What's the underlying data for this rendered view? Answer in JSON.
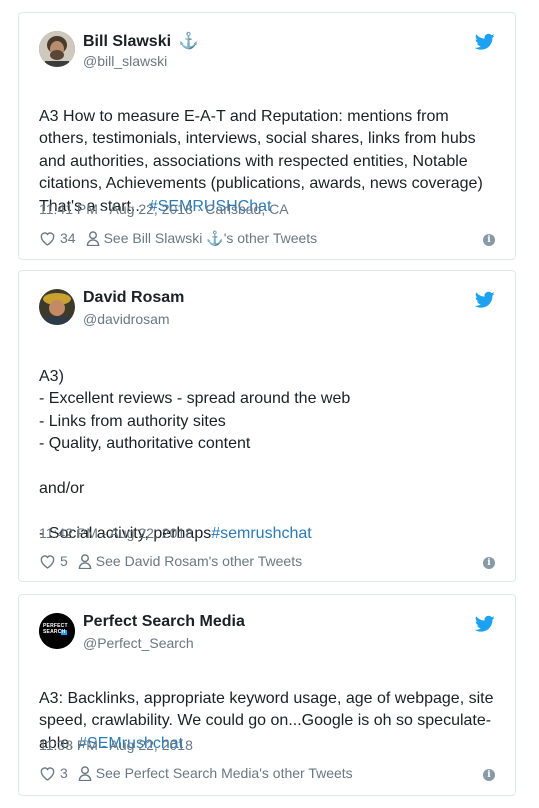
{
  "tweets": [
    {
      "name": "Bill Slawski",
      "name_suffix": "⚓",
      "handle": "@bill_slawski",
      "text": "A3 How to measure E-A-T and Reputation: mentions from others, testimonials, interviews, social shares, links from hubs and authorities, associations with respected entities, Notable citations, Achievements (publications, awards, news coverage) That's a start... ",
      "hashtag": "#SEMRUSHChat",
      "timestamp": "11:41 PM - Aug 22, 2018 · Carlsbad, CA",
      "likes": "34",
      "other_tweets": "See Bill Slawski ⚓'s other Tweets",
      "info_icon": "i"
    },
    {
      "name": "David Rosam",
      "handle": "@davidrosam",
      "text": "A3)\n- Excellent reviews - spread around the web\n- Links from authority sites\n- Quality, authoritative content\n\nand/or\n\n- Social activity, perhaps",
      "hashtag": "#semrushchat",
      "timestamp": "11:42 PM - Aug 22, 2018",
      "likes": "5",
      "other_tweets": "See David Rosam's other Tweets",
      "info_icon": "i"
    },
    {
      "name": "Perfect Search Media",
      "handle": "@Perfect_Search",
      "avatar_text": "PERFECT SEARCH",
      "text": "A3: Backlinks, appropriate keyword usage, age of webpage, site speed, crawlability. We could go on...Google is oh so speculate-able. ",
      "hashtag": "#SEMrushchat",
      "timestamp": "11:38 PM - Aug 22, 2018",
      "likes": "3",
      "other_tweets": "See Perfect Search Media's other Tweets",
      "info_icon": "i"
    }
  ],
  "colors": {
    "accent": "#1da1f2",
    "link": "#2b7bb9",
    "muted": "#697882",
    "border": "#e1e8ed"
  }
}
